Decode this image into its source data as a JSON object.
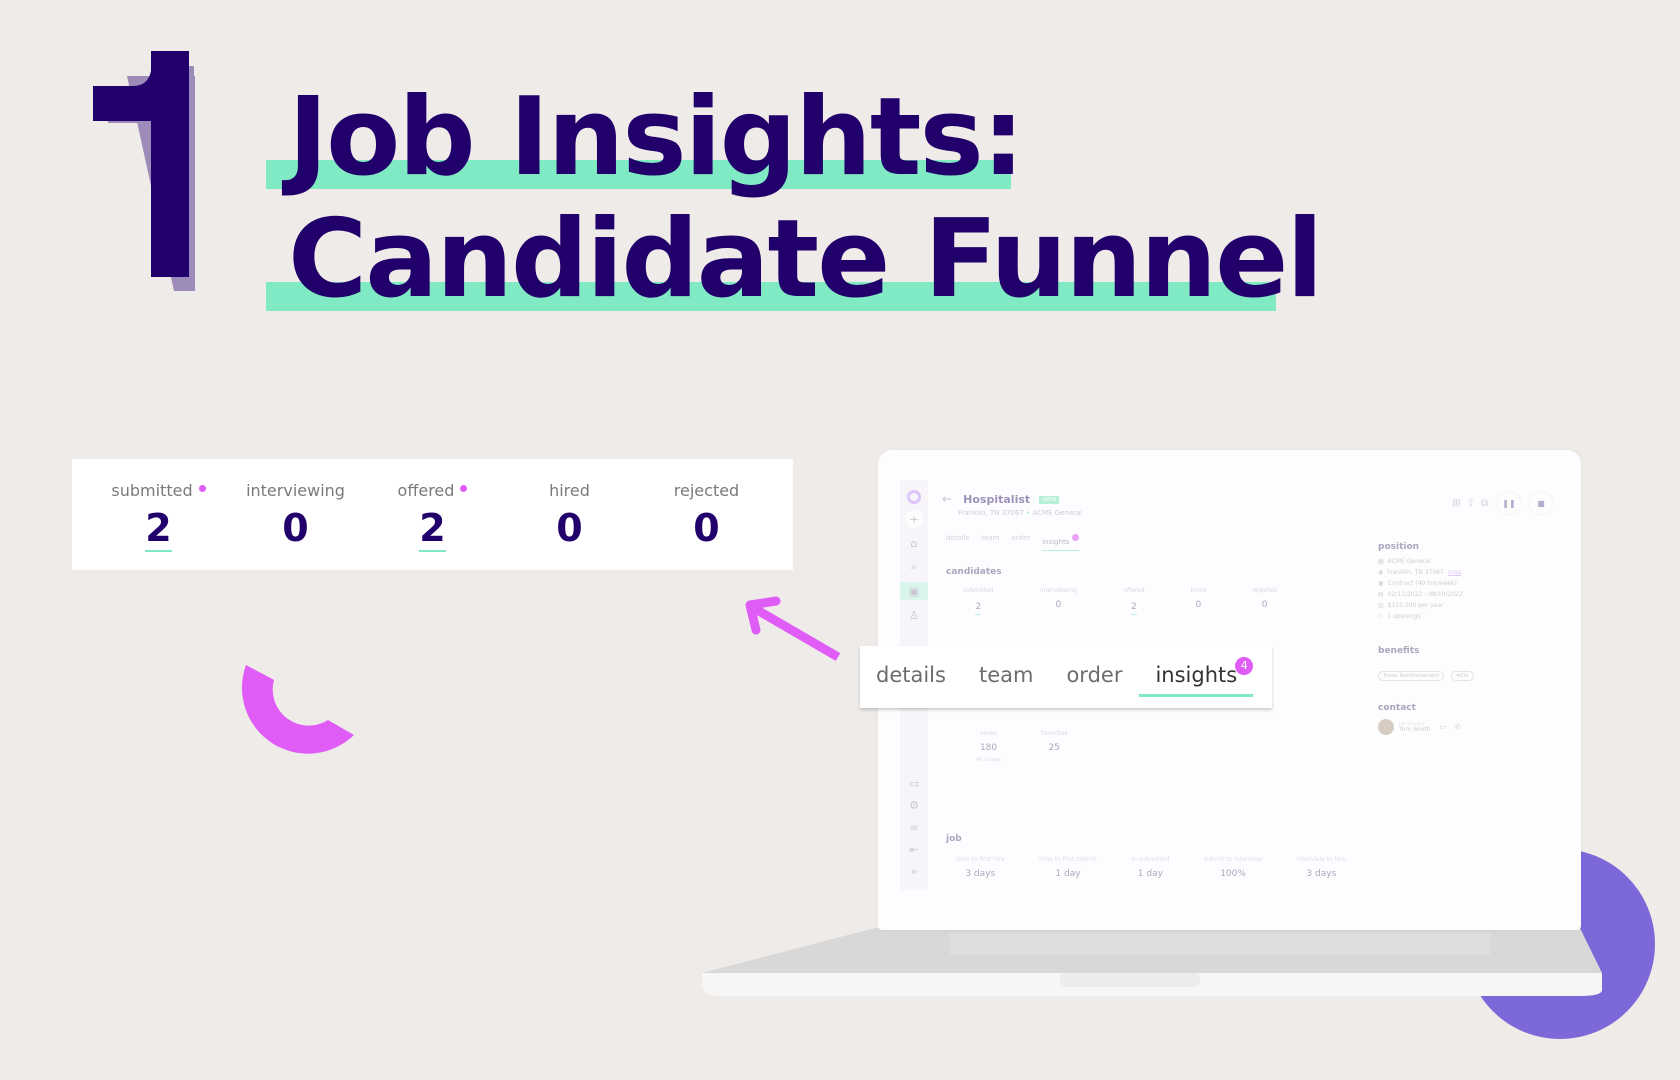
{
  "hero": {
    "numeral": "1",
    "title_line_1": "Job Insights:",
    "title_line_2": "Candidate Funnel"
  },
  "colors": {
    "primary": "#21006b",
    "highlight": "#80eac4",
    "accent_pink": "#e05cf7",
    "accent_purple": "#7d68d9",
    "background": "#efebe8"
  },
  "funnel": {
    "stats": [
      {
        "label": "submitted",
        "value": "2",
        "has_dot": true,
        "linked": true
      },
      {
        "label": "interviewing",
        "value": "0",
        "has_dot": false,
        "linked": false
      },
      {
        "label": "offered",
        "value": "2",
        "has_dot": true,
        "linked": true
      },
      {
        "label": "hired",
        "value": "0",
        "has_dot": false,
        "linked": false
      },
      {
        "label": "rejected",
        "value": "0",
        "has_dot": false,
        "linked": false
      }
    ]
  },
  "tabs_popup": {
    "tabs": [
      {
        "label": "details"
      },
      {
        "label": "team"
      },
      {
        "label": "order"
      },
      {
        "label": "insights",
        "badge": "4",
        "active": true
      }
    ]
  },
  "app": {
    "sidebar_icons": [
      "logo-icon",
      "plus-icon",
      "home-icon",
      "search-icon",
      "briefcase-icon",
      "person-icon",
      "chat-icon",
      "gear-icon",
      "link-icon",
      "logout-icon",
      "expand-icon"
    ],
    "header": {
      "back": "←",
      "title": "Hospitalist",
      "status_badge": "OPEN",
      "location": "Franklin, TN 37067",
      "client": "ACME General"
    },
    "actions": [
      "add-note-icon",
      "share-icon",
      "duplicate-icon"
    ],
    "pause_label": "❚❚",
    "stop_label": "■",
    "mini_tabs": [
      "details",
      "team",
      "order",
      "insights"
    ],
    "mini_badge": "4",
    "candidates_title": "candidates",
    "candidates": [
      {
        "label": "submitted",
        "value": "2"
      },
      {
        "label": "interviewing",
        "value": "0"
      },
      {
        "label": "offered",
        "value": "2"
      },
      {
        "label": "hired",
        "value": "0"
      },
      {
        "label": "rejected",
        "value": "0"
      }
    ],
    "engagement": {
      "views_label": "views",
      "views_value": "180",
      "views_sub": "40 unique",
      "favorites_label": "favorites",
      "favorites_value": "25"
    },
    "job": {
      "title": "job",
      "stats": [
        {
          "label": "time to first hire",
          "value": "3 days"
        },
        {
          "label": "time to first submit",
          "value": "1 day"
        },
        {
          "label": "in submitted",
          "value": "1 day"
        },
        {
          "label": "submit to interview",
          "value": "100%"
        },
        {
          "label": "interview to hire",
          "value": "3 days"
        }
      ]
    },
    "position": {
      "title": "position",
      "company": "ACME General",
      "location": "Franklin, TN 37067",
      "map_link": "map",
      "type": "Contract (40 hrs/week)",
      "dates": "02/11/2022 - 08/10/2022",
      "salary": "$125,000 per year",
      "openings": "1 openings"
    },
    "benefits": {
      "title": "benefits",
      "items": [
        "Travel Reimbursement",
        "401k"
      ]
    },
    "contact": {
      "title": "contact",
      "role": "job manager",
      "name": "Tom Smith"
    }
  }
}
